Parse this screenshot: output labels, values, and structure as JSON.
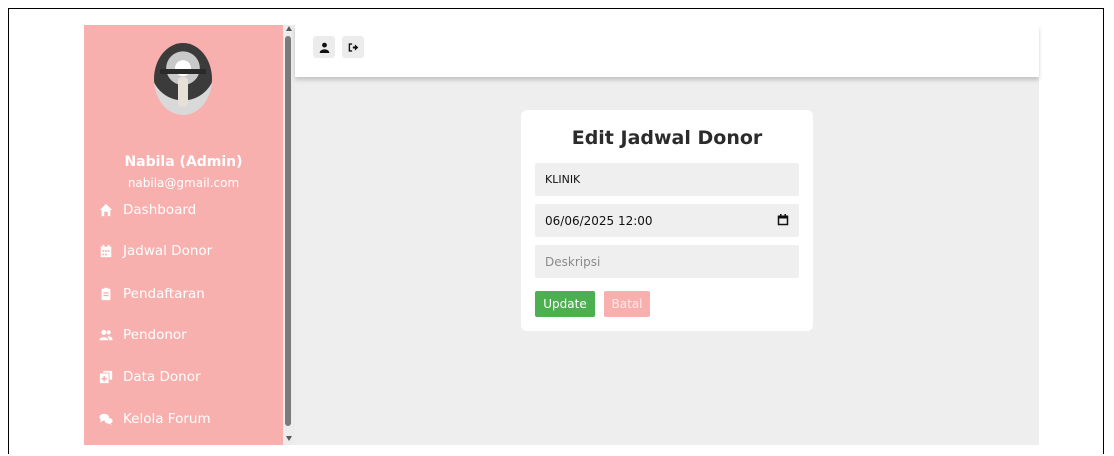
{
  "sidebar": {
    "user_name": "Nabila (Admin)",
    "user_email": "nabila@gmail.com",
    "items": [
      {
        "label": "Dashboard",
        "icon": "home-icon"
      },
      {
        "label": "Jadwal Donor",
        "icon": "calendar-icon"
      },
      {
        "label": "Pendaftaran",
        "icon": "clipboard-icon"
      },
      {
        "label": "Pendonor",
        "icon": "users-icon"
      },
      {
        "label": "Data Donor",
        "icon": "clone-icon"
      },
      {
        "label": "Kelola Forum",
        "icon": "comments-icon"
      }
    ]
  },
  "topbar": {
    "buttons": [
      {
        "icon": "user-icon"
      },
      {
        "icon": "sign-out-icon"
      }
    ]
  },
  "form": {
    "title": "Edit Jadwal Donor",
    "location_value": "KLINIK",
    "datetime_value": "06/06/2025 12:00",
    "description_placeholder": "Deskripsi",
    "update_label": "Update",
    "cancel_label": "Batal"
  },
  "colors": {
    "sidebar_bg": "#f8b0ae",
    "update_button": "#4caf50",
    "cancel_button": "#f8b0ae",
    "main_bg": "#eeeeee"
  }
}
